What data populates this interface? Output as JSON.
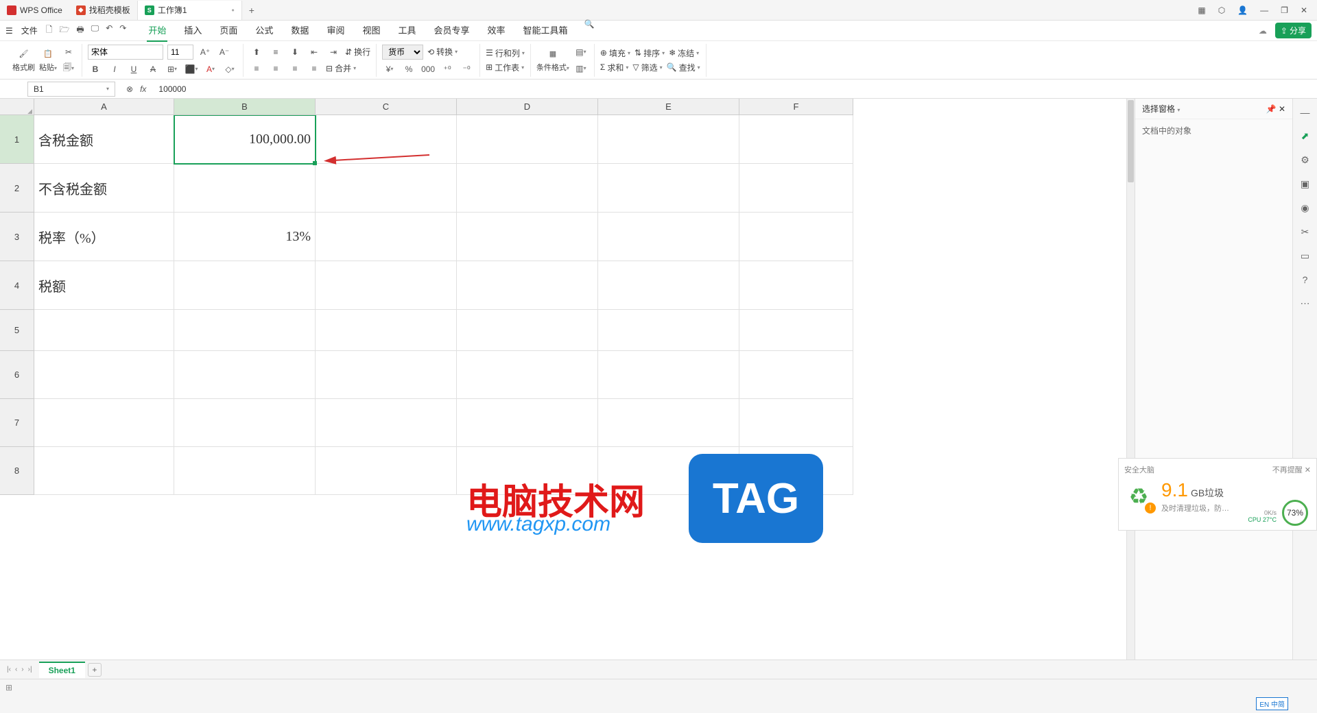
{
  "app": {
    "brand": "WPS Office"
  },
  "tabs": [
    {
      "icon_bg": "#d9452e",
      "label": "找稻壳模板"
    },
    {
      "icon_bg": "#18a058",
      "icon_text": "S",
      "label": "工作簿1",
      "active": true
    }
  ],
  "window_controls": [
    "▢",
    "⬡",
    "👤",
    "—",
    "❐",
    "✕"
  ],
  "menu": {
    "file": "文件",
    "items": [
      "开始",
      "插入",
      "页面",
      "公式",
      "数据",
      "审阅",
      "视图",
      "工具",
      "会员专享",
      "效率",
      "智能工具箱"
    ],
    "active": "开始",
    "quick_icons": [
      "🗋",
      "🔗",
      "🖶",
      "🖵",
      "↶",
      "↷"
    ],
    "share": "分享"
  },
  "ribbon": {
    "format_painter": "格式刷",
    "paste": "粘贴",
    "font_name": "宋体",
    "font_size": "11",
    "currency_label": "货币",
    "convert": "转换",
    "rowcol": "行和列",
    "worksheet": "工作表",
    "cond_fmt": "条件格式",
    "fill": "填充",
    "sort": "排序",
    "freeze": "冻结",
    "sum": "求和",
    "filter": "筛选",
    "find": "查找",
    "wrap": "换行",
    "merge": "合并"
  },
  "formula_bar": {
    "cell_ref": "B1",
    "value": "100000"
  },
  "columns": [
    "A",
    "B",
    "C",
    "D",
    "E",
    "F"
  ],
  "rows": [
    "1",
    "2",
    "3",
    "4",
    "5",
    "6",
    "7",
    "8"
  ],
  "cells": {
    "A1": "含税金额",
    "B1": "100,000.00",
    "A2": "不含税金额",
    "A3": "税率（%）",
    "B3": "13%",
    "A4": "税额"
  },
  "side_panel": {
    "title": "选择窗格",
    "sub": "文档中的对象"
  },
  "sheet": {
    "name": "Sheet1"
  },
  "watermark": {
    "text": "电脑技术网",
    "url": "www.tagxp.com",
    "tag": "TAG"
  },
  "cleanup": {
    "brand": "安全大脑",
    "dismiss": "不再提醒",
    "size": "9.1",
    "unit": "GB垃圾",
    "tip": "及时清理垃圾，防…",
    "cpu_pct": "73%",
    "cpu_label": "CPU 27°C",
    "net": "0K/s"
  },
  "ime": "EN 中简",
  "selected_col": "B",
  "selected_row": "1"
}
